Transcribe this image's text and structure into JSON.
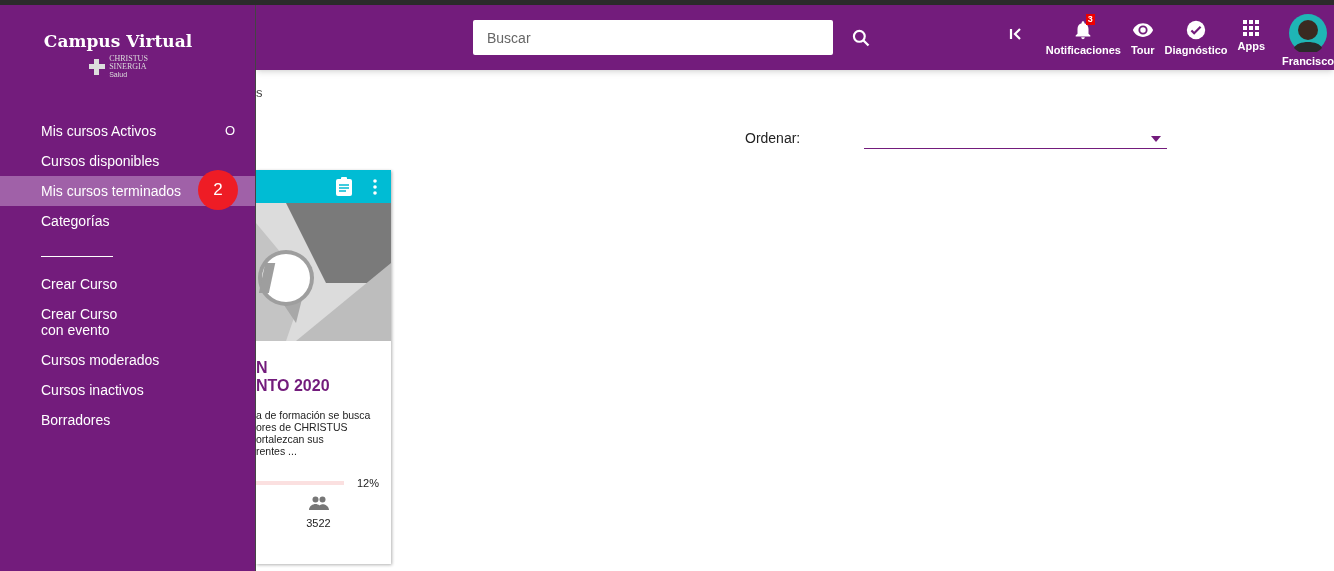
{
  "sidebar": {
    "logo": {
      "title": "Campus Virtual",
      "brand_lines": [
        "CHRISTUS",
        "SINERGIA"
      ],
      "brand_sub": "Salud"
    },
    "items": [
      {
        "label": "Mis cursos Activos",
        "selected": false,
        "marker": "O"
      },
      {
        "label": "Cursos disponibles",
        "selected": false
      },
      {
        "label": "Mis cursos terminados",
        "selected": true
      },
      {
        "label": "Categorías",
        "selected": false
      }
    ],
    "admin_items": [
      {
        "label": "Crear Curso",
        "selected": false
      },
      {
        "label": "Crear Curso\ncon evento",
        "selected": false
      },
      {
        "label": "Cursos moderados",
        "selected": false
      },
      {
        "label": "Cursos inactivos",
        "selected": false
      },
      {
        "label": "Borradores",
        "selected": false
      }
    ],
    "step_badge": "2"
  },
  "header": {
    "search": {
      "placeholder": "Buscar"
    },
    "actions": [
      {
        "kind": "collapse"
      },
      {
        "kind": "bell",
        "label": "Notificaciones",
        "badge": "3"
      },
      {
        "kind": "eye",
        "label": "Tour"
      },
      {
        "kind": "check",
        "label": "Diagnóstico"
      },
      {
        "kind": "apps",
        "label": "Apps"
      },
      {
        "kind": "avatar",
        "label": "Francisco"
      }
    ]
  },
  "breadcrumb": "s",
  "sort": {
    "label": "Ordenar:"
  },
  "card": {
    "title_lines": [
      "N",
      "NTO 2020"
    ],
    "description_lines": [
      "a de formación se busca",
      "ores de CHRISTUS",
      "ortalezcan sus",
      "rentes ..."
    ],
    "progress": "12%",
    "participants": "3522"
  }
}
